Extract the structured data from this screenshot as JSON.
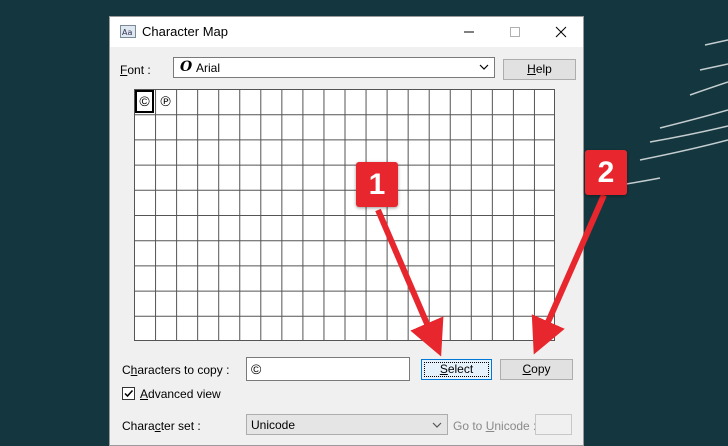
{
  "window": {
    "title": "Character Map"
  },
  "font_row": {
    "label_prefix": "",
    "label_mnemonic": "F",
    "label_rest": "ont :",
    "value": "Arial",
    "glyph": "O"
  },
  "help_button": {
    "mnemonic": "H",
    "rest": "elp"
  },
  "grid": {
    "columns": 20,
    "rows": 10,
    "visible_chars": [
      "©",
      "℗"
    ],
    "selected_index": 0
  },
  "copy_row": {
    "label_prefix": "C",
    "label_mnemonic": "h",
    "label_rest": "aracters to copy :",
    "value": "©"
  },
  "select_button": {
    "mnemonic": "S",
    "rest": "elect"
  },
  "copy_button": {
    "mnemonic": "C",
    "rest": "opy"
  },
  "advanced_view": {
    "label_prefix": "",
    "label_mnemonic": "A",
    "label_rest": "dvanced view",
    "checked": true
  },
  "charset_row": {
    "label_prefix": "Chara",
    "label_mnemonic": "c",
    "label_rest": "ter set :",
    "value": "Unicode"
  },
  "goto_row": {
    "label_prefix": "Go to ",
    "label_mnemonic": "U",
    "label_rest": "nicode :"
  },
  "callouts": [
    "1",
    "2"
  ],
  "colors": {
    "desktop": "#14373f",
    "callout": "#e8262e",
    "focus": "#0078d7"
  }
}
